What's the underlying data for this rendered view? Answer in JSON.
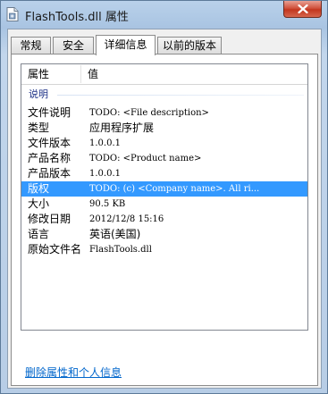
{
  "window": {
    "title": "FlashTools.dll 属性"
  },
  "tabs": [
    {
      "label": "常规",
      "active": false
    },
    {
      "label": "安全",
      "active": false
    },
    {
      "label": "详细信息",
      "active": true
    },
    {
      "label": "以前的版本",
      "active": false
    }
  ],
  "listview": {
    "columns": [
      "属性",
      "值"
    ],
    "group": "说明",
    "rows": [
      {
        "name": "文件说明",
        "value": "TODO: <File description>",
        "selected": false
      },
      {
        "name": "类型",
        "value": "应用程序扩展",
        "selected": false
      },
      {
        "name": "文件版本",
        "value": "1.0.0.1",
        "selected": false
      },
      {
        "name": "产品名称",
        "value": "TODO: <Product name>",
        "selected": false
      },
      {
        "name": "产品版本",
        "value": "1.0.0.1",
        "selected": false
      },
      {
        "name": "版权",
        "value": "TODO: (c) <Company name>.  All ri...",
        "selected": true
      },
      {
        "name": "大小",
        "value": "90.5 KB",
        "selected": false
      },
      {
        "name": "修改日期",
        "value": "2012/12/8 15:16",
        "selected": false
      },
      {
        "name": "语言",
        "value": "英语(美国)",
        "selected": false
      },
      {
        "name": "原始文件名",
        "value": "FlashTools.dll",
        "selected": false
      }
    ]
  },
  "footer": {
    "remove_link": "删除属性和个人信息"
  },
  "colors": {
    "selection": "#3399ff",
    "link": "#0066cc",
    "group_label": "#1e3287"
  },
  "icons": {
    "title": "dll-file-icon",
    "close": "close-icon"
  }
}
